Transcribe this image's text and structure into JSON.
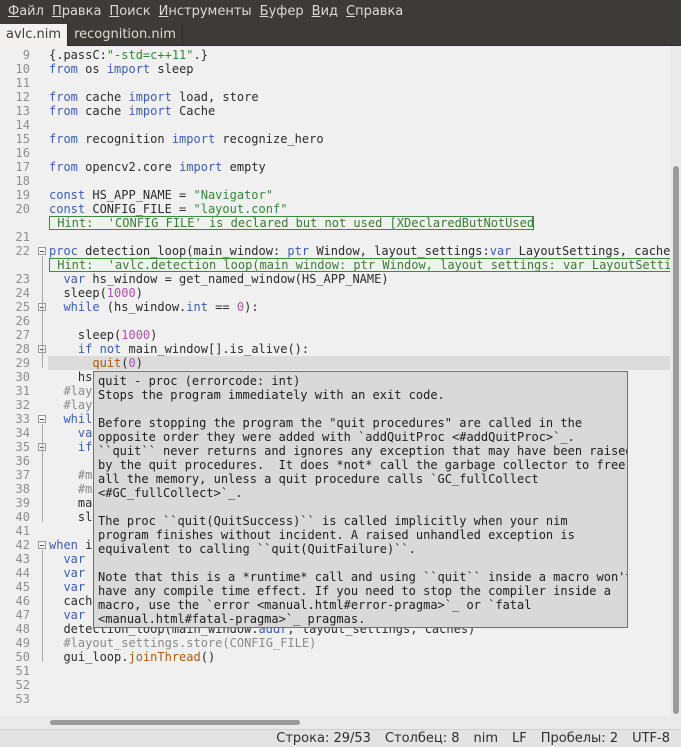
{
  "menu": {
    "items": [
      {
        "label": "Файл",
        "mnemonic": "Ф",
        "rest": "айл"
      },
      {
        "label": "Правка",
        "mnemonic": "П",
        "rest": "равка"
      },
      {
        "label": "Поиск",
        "mnemonic": "П",
        "rest": "оиск"
      },
      {
        "label": "Инструменты",
        "mnemonic": "И",
        "rest": "нструменты"
      },
      {
        "label": "Буфер",
        "mnemonic": "Б",
        "rest": "уфер"
      },
      {
        "label": "Вид",
        "mnemonic": "В",
        "rest": "ид"
      },
      {
        "label": "Справка",
        "mnemonic": "С",
        "rest": "правка"
      }
    ]
  },
  "tabs": [
    {
      "label": "avlc.nim",
      "active": true
    },
    {
      "label": "recognition.nim",
      "active": false
    }
  ],
  "editor": {
    "current_line": 29,
    "lines": [
      {
        "n": "9",
        "code": [
          [
            "t",
            "{.passC:"
          ],
          [
            "str",
            "\"-std=c++11\""
          ],
          [
            "t",
            ".}"
          ]
        ]
      },
      {
        "n": "10",
        "code": [
          [
            "kw",
            "from"
          ],
          [
            "t",
            " os "
          ],
          [
            "kw",
            "import"
          ],
          [
            "t",
            " sleep"
          ]
        ]
      },
      {
        "n": "11",
        "code": []
      },
      {
        "n": "12",
        "code": [
          [
            "kw",
            "from"
          ],
          [
            "t",
            " cache "
          ],
          [
            "kw",
            "import"
          ],
          [
            "t",
            " load, store"
          ]
        ]
      },
      {
        "n": "13",
        "code": [
          [
            "kw",
            "from"
          ],
          [
            "t",
            " cache "
          ],
          [
            "kw",
            "import"
          ],
          [
            "t",
            " Cache"
          ]
        ]
      },
      {
        "n": "14",
        "code": []
      },
      {
        "n": "15",
        "code": [
          [
            "kw",
            "from"
          ],
          [
            "t",
            " recognition "
          ],
          [
            "kw",
            "import"
          ],
          [
            "t",
            " recognize_hero"
          ]
        ]
      },
      {
        "n": "16",
        "code": []
      },
      {
        "n": "17",
        "code": [
          [
            "kw",
            "from"
          ],
          [
            "t",
            " opencv2.core "
          ],
          [
            "kw",
            "import"
          ],
          [
            "t",
            " empty"
          ]
        ]
      },
      {
        "n": "18",
        "code": []
      },
      {
        "n": "19",
        "code": [
          [
            "kw",
            "const"
          ],
          [
            "t",
            " HS_APP_NAME = "
          ],
          [
            "str",
            "\"Navigator\""
          ]
        ]
      },
      {
        "n": "20",
        "code": [
          [
            "kw",
            "const"
          ],
          [
            "t",
            " CONFIG_FILE = "
          ],
          [
            "str",
            "\"layout.conf\""
          ]
        ]
      },
      {
        "n": "",
        "code": [],
        "hint": " Hint:  'CONFIG_FILE' is declared but not used [XDeclaredButNotUsed]"
      },
      {
        "n": "21",
        "code": []
      },
      {
        "n": "22",
        "code": [
          [
            "kw",
            "proc"
          ],
          [
            "t",
            " detection_loop(main_window: "
          ],
          [
            "kw",
            "ptr"
          ],
          [
            "t",
            " Window, layout_settings:"
          ],
          [
            "kw",
            "var"
          ],
          [
            "t",
            " LayoutSettings, caches: "
          ]
        ],
        "fold": true
      },
      {
        "n": "",
        "code": [],
        "hint": " Hint:  'avlc.detection_loop(main_window: ptr Window, layout_settings: var LayoutSettings"
      },
      {
        "n": "23",
        "code": [
          [
            "t",
            "  "
          ],
          [
            "kw",
            "var"
          ],
          [
            "t",
            " hs_window = get_named_window(HS_APP_NAME)"
          ]
        ]
      },
      {
        "n": "24",
        "code": [
          [
            "t",
            "  sleep("
          ],
          [
            "num",
            "1000"
          ],
          [
            "t",
            ")"
          ]
        ]
      },
      {
        "n": "25",
        "code": [
          [
            "t",
            "  "
          ],
          [
            "kw",
            "while"
          ],
          [
            "t",
            " (hs_window."
          ],
          [
            "ty",
            "int"
          ],
          [
            "t",
            " == "
          ],
          [
            "num",
            "0"
          ],
          [
            "t",
            "):"
          ]
        ],
        "fold": true
      },
      {
        "n": "26",
        "code": []
      },
      {
        "n": "27",
        "code": [
          [
            "t",
            "    sleep("
          ],
          [
            "num",
            "1000"
          ],
          [
            "t",
            ")"
          ]
        ]
      },
      {
        "n": "28",
        "code": [
          [
            "t",
            "    "
          ],
          [
            "kw",
            "if"
          ],
          [
            "t",
            " "
          ],
          [
            "kw",
            "not"
          ],
          [
            "t",
            " main_window[].is_alive():"
          ]
        ],
        "fold": true
      },
      {
        "n": "29",
        "code": [
          [
            "t",
            "      "
          ],
          [
            "fn",
            "quit"
          ],
          [
            "t",
            "("
          ],
          [
            "num",
            "0"
          ],
          [
            "t",
            ")"
          ]
        ]
      },
      {
        "n": "30",
        "code": [
          [
            "t",
            "    hs"
          ]
        ]
      },
      {
        "n": "31",
        "code": [
          [
            "t",
            "  "
          ],
          [
            "cmt",
            "#lay"
          ]
        ]
      },
      {
        "n": "32",
        "code": [
          [
            "t",
            "  "
          ],
          [
            "cmt",
            "#lay"
          ]
        ]
      },
      {
        "n": "33",
        "code": [
          [
            "t",
            "  "
          ],
          [
            "kw",
            "whil"
          ]
        ],
        "fold": true
      },
      {
        "n": "34",
        "code": [
          [
            "t",
            "    "
          ],
          [
            "kw",
            "va"
          ]
        ]
      },
      {
        "n": "35",
        "code": [
          [
            "t",
            "    "
          ],
          [
            "kw",
            "if"
          ]
        ],
        "fold": true
      },
      {
        "n": "36",
        "code": [
          [
            "t",
            "      "
          ]
        ]
      },
      {
        "n": "37",
        "code": [
          [
            "t",
            "    "
          ],
          [
            "cmt",
            "#ma"
          ]
        ]
      },
      {
        "n": "38",
        "code": [
          [
            "t",
            "    "
          ],
          [
            "cmt",
            "#ma"
          ]
        ]
      },
      {
        "n": "39",
        "code": [
          [
            "t",
            "    ma"
          ]
        ]
      },
      {
        "n": "40",
        "code": [
          [
            "t",
            "    sle"
          ]
        ]
      },
      {
        "n": "41",
        "code": []
      },
      {
        "n": "42",
        "code": [
          [
            "kw",
            "when"
          ],
          [
            "t",
            " is"
          ]
        ],
        "fold": true
      },
      {
        "n": "43",
        "code": [
          [
            "t",
            "  "
          ],
          [
            "kw",
            "var"
          ],
          [
            "t",
            " m"
          ]
        ]
      },
      {
        "n": "44",
        "code": [
          [
            "t",
            "  "
          ],
          [
            "kw",
            "var"
          ],
          [
            "t",
            " "
          ]
        ]
      },
      {
        "n": "45",
        "code": [
          [
            "t",
            "  "
          ],
          [
            "kw",
            "var"
          ],
          [
            "t",
            " c"
          ]
        ]
      },
      {
        "n": "46",
        "code": [
          [
            "t",
            "  cache"
          ]
        ]
      },
      {
        "n": "47",
        "code": [
          [
            "t",
            "  "
          ],
          [
            "kw",
            "var"
          ],
          [
            "t",
            " c"
          ]
        ]
      },
      {
        "n": "48",
        "code": [
          [
            "t",
            "  detection_loop(main_window."
          ],
          [
            "kw",
            "addr"
          ],
          [
            "t",
            ", layout_settings, caches)"
          ]
        ]
      },
      {
        "n": "49",
        "code": [
          [
            "t",
            "  "
          ],
          [
            "cmt",
            "#layout_settings.store(CONFIG_FILE)"
          ]
        ]
      },
      {
        "n": "50",
        "code": [
          [
            "t",
            "  gui_loop."
          ],
          [
            "fn",
            "joinThread"
          ],
          [
            "t",
            "()"
          ]
        ]
      },
      {
        "n": "51",
        "code": []
      },
      {
        "n": "52",
        "code": []
      },
      {
        "n": "53",
        "code": []
      }
    ]
  },
  "tooltip": {
    "lines": [
      "quit - proc (errorcode: int)",
      "Stops the program immediately with an exit code.",
      "",
      "Before stopping the program the \"quit procedures\" are called in the",
      "opposite order they were added with `addQuitProc <#addQuitProc>`_.",
      "``quit`` never returns and ignores any exception that may have been raised",
      "by the quit procedures.  It does *not* call the garbage collector to free",
      "all the memory, unless a quit procedure calls `GC_fullCollect",
      "<#GC_fullCollect>`_.",
      "",
      "The proc ``quit(QuitSuccess)`` is called implicitly when your nim",
      "program finishes without incident. A raised unhandled exception is",
      "equivalent to calling ``quit(QuitFailure)``.",
      "",
      "Note that this is a *runtime* call and using ``quit`` inside a macro won't",
      "have any compile time effect. If you need to stop the compiler inside a",
      "macro, use the `error <manual.html#error-pragma>`_ or `fatal",
      "<manual.html#fatal-pragma>`_ pragmas."
    ]
  },
  "status": {
    "position": "Строка: 29/53",
    "column": "Столбец: 8",
    "language": "nim",
    "line_ending": "LF",
    "indent": "Пробелы: 2",
    "encoding": "UTF-8"
  }
}
